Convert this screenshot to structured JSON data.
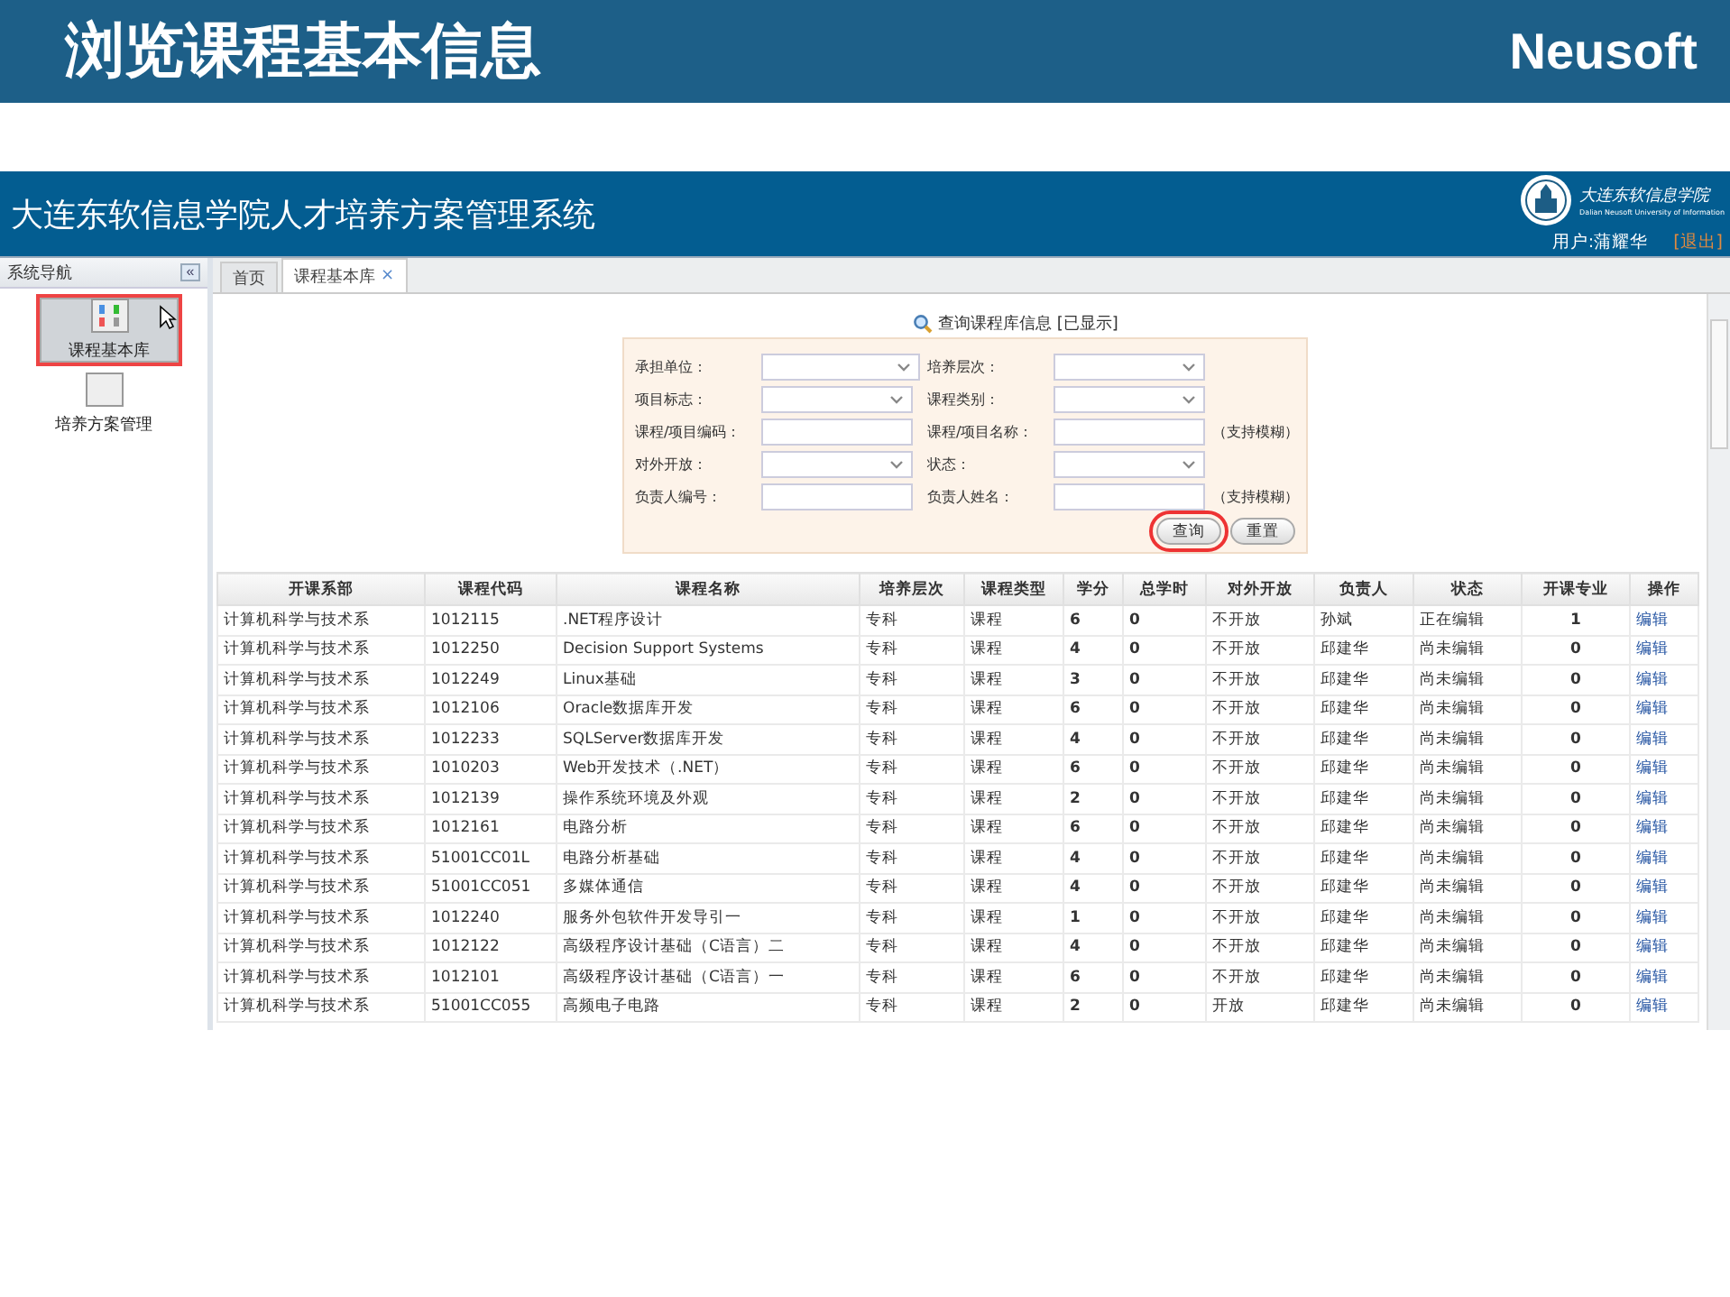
{
  "slide": {
    "title": "浏览课程基本信息",
    "brand": "Neusoft"
  },
  "app": {
    "title": "大连东软信息学院人才培养方案管理系统",
    "logo_name": "大连东软信息学院",
    "logo_subtitle": "Dalian Neusoft University of Information",
    "user": "用户:蒲耀华",
    "logout": "[退出]"
  },
  "sidebar": {
    "title": "系统导航",
    "collapse": "«",
    "items": [
      {
        "label": "课程基本库",
        "selected": true
      },
      {
        "label": "培养方案管理",
        "selected": false
      }
    ]
  },
  "tabs": [
    {
      "label": "首页",
      "selected": false
    },
    {
      "label": "课程基本库",
      "selected": true,
      "close": "×"
    }
  ],
  "query": {
    "title": "查询课程库信息 [已显示]",
    "fields": [
      {
        "label": "承担单位：",
        "kind": "select"
      },
      {
        "label": "培养层次：",
        "kind": "select"
      },
      {
        "label": "项目标志：",
        "kind": "select"
      },
      {
        "label": "课程类别：",
        "kind": "select"
      },
      {
        "label": "课程/项目编码：",
        "kind": "text"
      },
      {
        "label": "课程/项目名称：",
        "kind": "text",
        "hint": "（支持模糊）"
      },
      {
        "label": "对外开放：",
        "kind": "select"
      },
      {
        "label": "状态：",
        "kind": "select"
      },
      {
        "label": "负责人编号：",
        "kind": "text"
      },
      {
        "label": "负责人姓名：",
        "kind": "text",
        "hint": "（支持模糊）"
      }
    ],
    "buttons": [
      {
        "label": "查询",
        "highlighted": true
      },
      {
        "label": "重置",
        "highlighted": false
      }
    ]
  },
  "table": {
    "columns": [
      "开课系部",
      "课程代码",
      "课程名称",
      "培养层次",
      "课程类型",
      "学分",
      "总学时",
      "对外开放",
      "负责人",
      "状态",
      "开课专业",
      "操作"
    ],
    "rows": [
      [
        "计算机科学与技术系",
        "1012115",
        ".NET程序设计",
        "专科",
        "课程",
        "6",
        "0",
        "不开放",
        "孙斌",
        "正在编辑",
        "1",
        "编辑"
      ],
      [
        "计算机科学与技术系",
        "1012250",
        "Decision Support Systems",
        "专科",
        "课程",
        "4",
        "0",
        "不开放",
        "邱建华",
        "尚未编辑",
        "0",
        "编辑"
      ],
      [
        "计算机科学与技术系",
        "1012249",
        "Linux基础",
        "专科",
        "课程",
        "3",
        "0",
        "不开放",
        "邱建华",
        "尚未编辑",
        "0",
        "编辑"
      ],
      [
        "计算机科学与技术系",
        "1012106",
        "Oracle数据库开发",
        "专科",
        "课程",
        "6",
        "0",
        "不开放",
        "邱建华",
        "尚未编辑",
        "0",
        "编辑"
      ],
      [
        "计算机科学与技术系",
        "1012233",
        "SQLServer数据库开发",
        "专科",
        "课程",
        "4",
        "0",
        "不开放",
        "邱建华",
        "尚未编辑",
        "0",
        "编辑"
      ],
      [
        "计算机科学与技术系",
        "1010203",
        "Web开发技术（.NET）",
        "专科",
        "课程",
        "6",
        "0",
        "不开放",
        "邱建华",
        "尚未编辑",
        "0",
        "编辑"
      ],
      [
        "计算机科学与技术系",
        "1012139",
        "操作系统环境及外观",
        "专科",
        "课程",
        "2",
        "0",
        "不开放",
        "邱建华",
        "尚未编辑",
        "0",
        "编辑"
      ],
      [
        "计算机科学与技术系",
        "1012161",
        "电路分析",
        "专科",
        "课程",
        "6",
        "0",
        "不开放",
        "邱建华",
        "尚未编辑",
        "0",
        "编辑"
      ],
      [
        "计算机科学与技术系",
        "51001CC01L",
        "电路分析基础",
        "专科",
        "课程",
        "4",
        "0",
        "不开放",
        "邱建华",
        "尚未编辑",
        "0",
        "编辑"
      ],
      [
        "计算机科学与技术系",
        "51001CC051",
        "多媒体通信",
        "专科",
        "课程",
        "4",
        "0",
        "不开放",
        "邱建华",
        "尚未编辑",
        "0",
        "编辑"
      ],
      [
        "计算机科学与技术系",
        "1012240",
        "服务外包软件开发导引一",
        "专科",
        "课程",
        "1",
        "0",
        "不开放",
        "邱建华",
        "尚未编辑",
        "0",
        "编辑"
      ],
      [
        "计算机科学与技术系",
        "1012122",
        "高级程序设计基础（C语言）二",
        "专科",
        "课程",
        "4",
        "0",
        "不开放",
        "邱建华",
        "尚未编辑",
        "0",
        "编辑"
      ],
      [
        "计算机科学与技术系",
        "1012101",
        "高级程序设计基础（C语言）一",
        "专科",
        "课程",
        "6",
        "0",
        "不开放",
        "邱建华",
        "尚未编辑",
        "0",
        "编辑"
      ],
      [
        "计算机科学与技术系",
        "51001CC055",
        "高频电子电路",
        "专科",
        "课程",
        "2",
        "0",
        "开放",
        "邱建华",
        "尚未编辑",
        "0",
        "编辑"
      ]
    ]
  }
}
